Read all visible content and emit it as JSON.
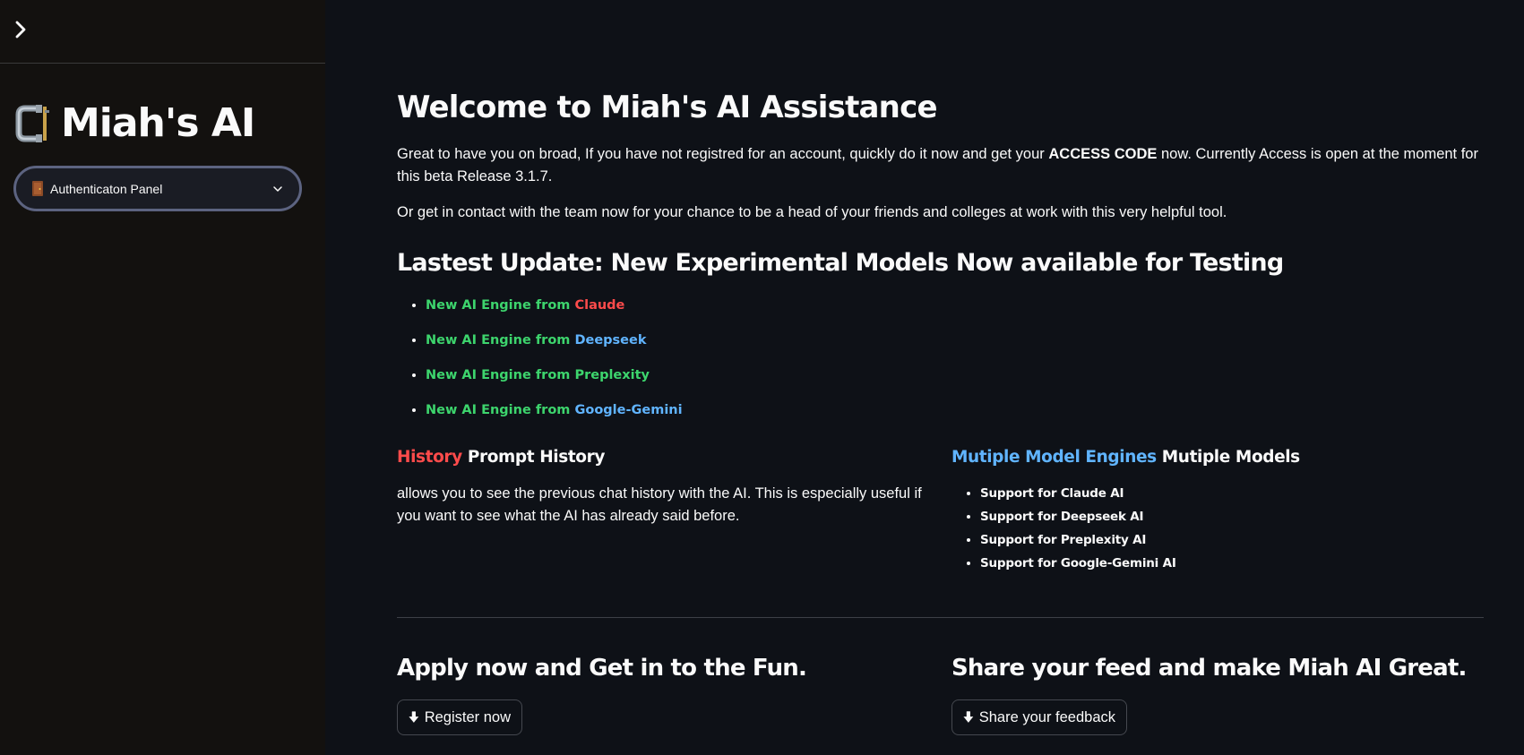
{
  "colors": {
    "background": "#0e1117",
    "sidebar": "#13110f",
    "green": "#3dd56d",
    "red": "#ff4b4b",
    "blue": "#60b4ff",
    "text": "#fafafa"
  },
  "sidebar": {
    "toggle_icon": "chevron-right-icon",
    "brand_icon": "clamp-icon",
    "brand_title": "Miah's AI",
    "select": {
      "icon": "door-icon",
      "label": "Authenticaton Panel",
      "caret_icon": "chevron-down-icon"
    }
  },
  "main": {
    "welcome_title": "Welcome to Miah's AI Assistance",
    "intro": {
      "before": "Great to have you on broad, If you have not registred for an account, quickly do it now and get your ",
      "bold": "ACCESS CODE",
      "after": " now. Currently Access is open at the moment for this beta Release 3.1.7."
    },
    "contact_text": "Or get in contact with the team now for your chance to be a head of your friends and colleges at work with this very helpful tool.",
    "update_title": "Lastest Update: New Experimental Models Now available for Testing",
    "engines": [
      {
        "prefix": "New AI Engine from ",
        "name": "Claude",
        "color": "red"
      },
      {
        "prefix": "New AI Engine from ",
        "name": "Deepseek",
        "color": "blue"
      },
      {
        "prefix": "New AI Engine from ",
        "name": "Preplexity",
        "color": "green"
      },
      {
        "prefix": "New AI Engine from ",
        "name": "Google-Gemini",
        "color": "blue"
      }
    ],
    "history": {
      "tag": "History",
      "title": "Prompt History",
      "text": "allows you to see the previous chat history with the AI. This is especially useful if you want to see what the AI has already said before."
    },
    "models": {
      "tag": "Mutiple Model Engines",
      "title": "Mutiple Models",
      "items": [
        "Support for Claude AI",
        "Support for Deepseek AI",
        "Support for Preplexity AI",
        "Support for Google-Gemini AI"
      ]
    },
    "apply": {
      "title": "Apply now and Get in to the Fun.",
      "button_label": "Register now",
      "button_icon": "download-arrow-icon"
    },
    "share": {
      "title": "Share your feed and make Miah AI Great.",
      "button_label": "Share your feedback",
      "button_icon": "download-arrow-icon"
    }
  }
}
